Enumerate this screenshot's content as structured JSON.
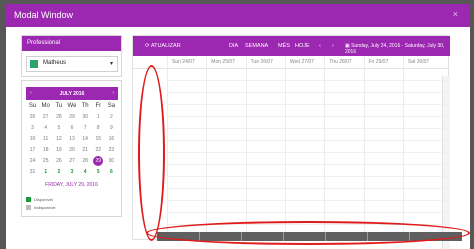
{
  "modal": {
    "title": "Modal Window",
    "close": "×"
  },
  "professional": {
    "label": "Professional",
    "selected": "Matheus",
    "swatch_color": "#2aa36b",
    "caret": "▾"
  },
  "calendar": {
    "month": "JULY 2016",
    "prev": "‹",
    "next": "›",
    "dow": [
      "Su",
      "Mo",
      "Tu",
      "We",
      "Th",
      "Fr",
      "Sa"
    ],
    "days": [
      {
        "d": "26",
        "s": "muted"
      },
      {
        "d": "27",
        "s": "muted"
      },
      {
        "d": "28",
        "s": "muted"
      },
      {
        "d": "29",
        "s": "muted"
      },
      {
        "d": "30",
        "s": "muted"
      },
      {
        "d": "1",
        "s": "muted"
      },
      {
        "d": "2",
        "s": "muted"
      },
      {
        "d": "3",
        "s": "muted"
      },
      {
        "d": "4",
        "s": "muted"
      },
      {
        "d": "5",
        "s": "muted"
      },
      {
        "d": "6",
        "s": "muted"
      },
      {
        "d": "7",
        "s": "muted"
      },
      {
        "d": "8",
        "s": "muted"
      },
      {
        "d": "9",
        "s": "muted"
      },
      {
        "d": "10",
        "s": "muted"
      },
      {
        "d": "11",
        "s": "muted"
      },
      {
        "d": "12",
        "s": "muted"
      },
      {
        "d": "13",
        "s": "muted"
      },
      {
        "d": "14",
        "s": "muted"
      },
      {
        "d": "15",
        "s": "muted"
      },
      {
        "d": "16",
        "s": "muted"
      },
      {
        "d": "17",
        "s": "muted"
      },
      {
        "d": "18",
        "s": "muted"
      },
      {
        "d": "19",
        "s": "muted"
      },
      {
        "d": "20",
        "s": "muted"
      },
      {
        "d": "21",
        "s": "muted"
      },
      {
        "d": "22",
        "s": "muted"
      },
      {
        "d": "23",
        "s": "muted"
      },
      {
        "d": "24",
        "s": "muted"
      },
      {
        "d": "25",
        "s": "muted"
      },
      {
        "d": "26",
        "s": "muted"
      },
      {
        "d": "27",
        "s": "muted"
      },
      {
        "d": "28",
        "s": "muted"
      },
      {
        "d": "29",
        "s": "sel"
      },
      {
        "d": "30",
        "s": "muted"
      },
      {
        "d": "31",
        "s": "muted"
      },
      {
        "d": "1",
        "s": "avail"
      },
      {
        "d": "2",
        "s": "avail"
      },
      {
        "d": "3",
        "s": "avail"
      },
      {
        "d": "4",
        "s": "avail"
      },
      {
        "d": "5",
        "s": "avail"
      },
      {
        "d": "6",
        "s": "avail"
      }
    ],
    "today": "FRIDAY, JULY 29, 2016"
  },
  "legend": [
    {
      "label": "Disponível",
      "color": "#1a9a3a"
    },
    {
      "label": "Indisponível",
      "color": "#bdbdbd"
    }
  ],
  "toolbar": {
    "refresh": "⟳ ATUALIZAR",
    "day": "DIA",
    "week": "SEMANA",
    "month": "MÊS",
    "today": "HOJE",
    "prev": "‹",
    "next": "›",
    "range": "▣ Sunday, July 24, 2016 - Saturday, July 30, 2016"
  },
  "columns": [
    "Sun 24/07",
    "Mon 25/07",
    "Tue 26/07",
    "Wed 27/07",
    "Thu 28/07",
    "Fri 29/07",
    "Sat 30/07"
  ],
  "colors": {
    "accent": "#9c27b0",
    "annotation": "#e01b1b"
  }
}
